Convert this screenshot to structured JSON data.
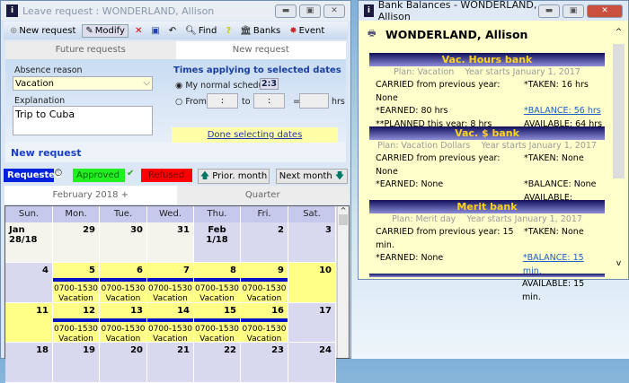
{
  "left": {
    "title": "Leave request : WONDERLAND, Allison",
    "toolbar": {
      "new_request": "New request",
      "modify": "Modify",
      "find": "Find",
      "banks": "Banks",
      "event": "Event"
    },
    "tabs": [
      "Future requests",
      "New request"
    ],
    "absence_reason_label": "Absence reason",
    "absence_reason_value": "Vacation",
    "explanation_label": "Explanation",
    "explanation_value": "Trip to Cuba",
    "times_title": "Times applying to selected dates",
    "normal_schedule": "My normal schedule",
    "from": "From",
    "to": "to",
    "eq": "=",
    "hrs": "hrs",
    "time_placeholder": ":",
    "done_link": "Done selecting dates",
    "section_title": "New request",
    "legend": {
      "requested": "Requested",
      "approved": "Approved",
      "refused": "Refused"
    },
    "prior_month": "Prior. month",
    "next_month": "Next month",
    "month_tabs": [
      "February 2018 +",
      "Quarter"
    ],
    "weekdays": [
      "Sun.",
      "Mon.",
      "Tue.",
      "Wed.",
      "Thu.",
      "Fri.",
      "Sat."
    ],
    "weeks": [
      [
        {
          "d": "Jan 28/18",
          "s": "other"
        },
        {
          "d": "29",
          "s": "other"
        },
        {
          "d": "30",
          "s": "other"
        },
        {
          "d": "31",
          "s": "other"
        },
        {
          "d": "Feb 1/18",
          "s": "plain"
        },
        {
          "d": "2",
          "s": "plain"
        },
        {
          "d": "3",
          "s": "plain"
        }
      ],
      [
        {
          "d": "4",
          "s": "plain"
        },
        {
          "d": "5",
          "s": "sel",
          "t": "0700-1530",
          "r": "Vacation"
        },
        {
          "d": "6",
          "s": "sel",
          "t": "0700-1530",
          "r": "Vacation"
        },
        {
          "d": "7",
          "s": "sel",
          "t": "0700-1530",
          "r": "Vacation"
        },
        {
          "d": "8",
          "s": "sel",
          "t": "0700-1530",
          "r": "Vacation"
        },
        {
          "d": "9",
          "s": "sel",
          "t": "0700-1530",
          "r": "Vacation"
        },
        {
          "d": "10",
          "s": "sel"
        }
      ],
      [
        {
          "d": "11",
          "s": "sel"
        },
        {
          "d": "12",
          "s": "sel",
          "t": "0700-1530",
          "r": "Vacation"
        },
        {
          "d": "13",
          "s": "sel",
          "t": "0700-1530",
          "r": "Vacation"
        },
        {
          "d": "14",
          "s": "sel",
          "t": "0700-1530",
          "r": "Vacation"
        },
        {
          "d": "15",
          "s": "sel",
          "t": "0700-1530",
          "r": "Vacation"
        },
        {
          "d": "16",
          "s": "sel",
          "t": "0700-1530",
          "r": "Vacation"
        },
        {
          "d": "17",
          "s": "plain"
        }
      ],
      [
        {
          "d": "18",
          "s": "plain"
        },
        {
          "d": "19",
          "s": "plain"
        },
        {
          "d": "20",
          "s": "plain"
        },
        {
          "d": "21",
          "s": "plain"
        },
        {
          "d": "22",
          "s": "plain"
        },
        {
          "d": "23",
          "s": "plain"
        },
        {
          "d": "24",
          "s": "plain"
        }
      ]
    ]
  },
  "right": {
    "title": "Bank Balances - WONDERLAND, Allison",
    "employee": "WONDERLAND, Allison",
    "banks": [
      {
        "name": "Vac. Hours bank",
        "plan": "Plan: Vacation",
        "year": "Year starts January 1, 2017",
        "rows": [
          [
            "CARRIED from previous year: None",
            "*TAKEN: 16 hrs"
          ],
          [
            "*EARNED: 80 hrs",
            "*BALANCE: 56 hrs"
          ],
          [
            "**PLANNED this year: 8 hrs",
            "AVAILABLE: 64 hrs"
          ]
        ],
        "balance_link": true
      },
      {
        "name": "Vac. $ bank",
        "plan": "Plan: Vacation Dollars",
        "year": "Year starts January 1, 2017",
        "rows": [
          [
            "CARRIED from previous year: None",
            "*TAKEN: None"
          ],
          [
            "*EARNED: None",
            "*BALANCE: None"
          ],
          [
            "",
            "AVAILABLE:"
          ]
        ],
        "balance_link": false
      },
      {
        "name": "Merit bank",
        "plan": "Plan: Merit day",
        "year": "Year starts January 1, 2017",
        "rows": [
          [
            "CARRIED from previous year: 15 min.",
            "*TAKEN: None"
          ],
          [
            "*EARNED: None",
            "*BALANCE: 15 min."
          ],
          [
            "",
            "AVAILABLE: 15 min."
          ]
        ],
        "balance_link": true
      }
    ]
  },
  "colors": {
    "requested": "#0022dd",
    "approved": "#22ee22",
    "refused": "#ff0000",
    "selected_day": "#ffff88",
    "plain_day": "#d8d9ef",
    "other_day": "#f4f4ec",
    "bank_header_text": "#ffd21a"
  }
}
